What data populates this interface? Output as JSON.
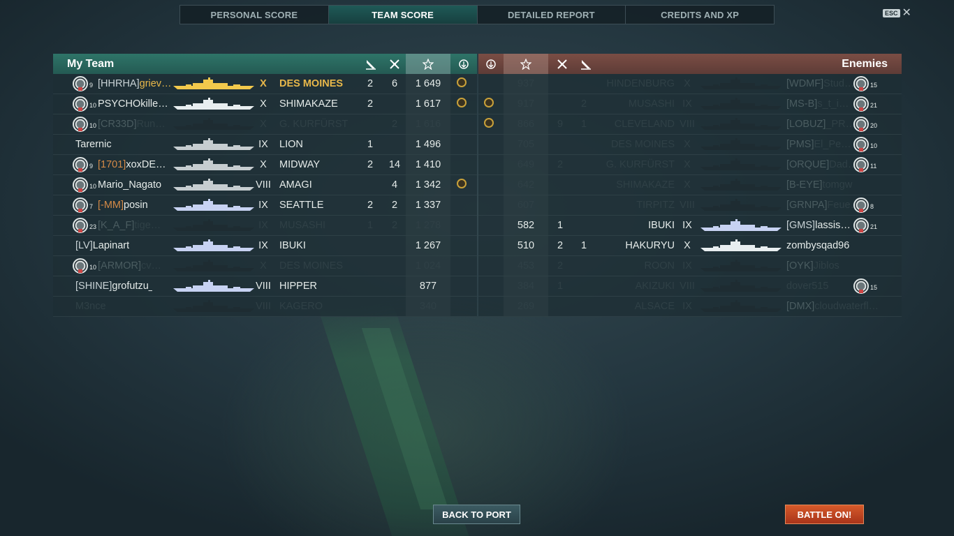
{
  "tabs": [
    "PERSONAL SCORE",
    "TEAM SCORE",
    "DETAILED REPORT",
    "CREDITS AND XP"
  ],
  "active_tab": 1,
  "close": {
    "key": "ESC",
    "glyph": "✕"
  },
  "left_header": {
    "title": "My Team"
  },
  "right_header": {
    "title": "Enemies"
  },
  "buttons": {
    "back": "BACK TO PORT",
    "battle": "BATTLE ON!"
  },
  "colors": {
    "my_team": "#2e7468",
    "enemies": "#7a4d44",
    "highlight": "#e8b84a",
    "clan_orange": "#d48a47"
  },
  "my_team": [
    {
      "rank": "9",
      "clan": "[HHRHA]",
      "clan_color": "white",
      "name": "griev…",
      "tier": "X",
      "ship": "DES MOINES",
      "k1": "2",
      "k2": "6",
      "score": "1 649",
      "medal": true,
      "self": true,
      "dead": false,
      "ship_color": "gold"
    },
    {
      "rank": "10",
      "clan": "",
      "name": "PSYCHOkille…",
      "tier": "X",
      "ship": "SHIMAKAZE",
      "k1": "2",
      "k2": "",
      "score": "1 617",
      "medal": true,
      "dead": false,
      "ship_color": "white"
    },
    {
      "rank": "10",
      "clan": "[CR33D]",
      "clan_color": "white",
      "name": "Run…",
      "tier": "X",
      "ship": "G. KURFÜRST",
      "k1": "",
      "k2": "2",
      "score": "1 616",
      "medal": false,
      "dead": true,
      "ship_color": "dark"
    },
    {
      "rank": "",
      "clan": "",
      "name": "Tarernic",
      "tier": "IX",
      "ship": "LION",
      "k1": "1",
      "k2": "",
      "score": "1 496",
      "medal": false,
      "dead": false,
      "ship_color": "grey"
    },
    {
      "rank": "9",
      "clan": "[1701]",
      "clan_color": "orange",
      "name": "xoxDE…",
      "tier": "X",
      "ship": "MIDWAY",
      "k1": "2",
      "k2": "14",
      "score": "1 410",
      "medal": false,
      "dead": false,
      "ship_color": "grey"
    },
    {
      "rank": "10",
      "clan": "",
      "name": "Mario_Nagato",
      "tier": "VIII",
      "ship": "AMAGI",
      "k1": "",
      "k2": "4",
      "score": "1 342",
      "medal": true,
      "dead": false,
      "ship_color": "grey"
    },
    {
      "rank": "7",
      "clan": "[-MM]",
      "clan_color": "orange",
      "name": "posin",
      "tier": "IX",
      "ship": "SEATTLE",
      "k1": "2",
      "k2": "2",
      "score": "1 337",
      "medal": false,
      "dead": false,
      "ship_color": "blue"
    },
    {
      "rank": "23",
      "clan": "[K_A_F]",
      "clan_color": "white",
      "name": "tige…",
      "tier": "IX",
      "ship": "MUSASHI",
      "k1": "1",
      "k2": "2",
      "score": "1 278",
      "medal": false,
      "dead": true,
      "ship_color": "dark"
    },
    {
      "rank": "",
      "clan": "[LV]",
      "clan_color": "white",
      "name": "Lapinart",
      "tier": "IX",
      "ship": "IBUKI",
      "k1": "",
      "k2": "",
      "score": "1 267",
      "medal": false,
      "dead": false,
      "ship_color": "blue"
    },
    {
      "rank": "10",
      "clan": "[ARMOR]",
      "clan_color": "orange",
      "name": "cv…",
      "tier": "X",
      "ship": "DES MOINES",
      "k1": "",
      "k2": "",
      "score": "1 024",
      "medal": false,
      "dead": true,
      "ship_color": "dark"
    },
    {
      "rank": "",
      "clan": "[SHINE]",
      "clan_color": "white",
      "name": "grofutzu_1",
      "tier": "VIII",
      "ship": "HIPPER",
      "k1": "",
      "k2": "",
      "score": "877",
      "medal": false,
      "dead": false,
      "ship_color": "blue"
    },
    {
      "rank": "",
      "clan": "",
      "name": "M3nce",
      "tier": "VIII",
      "ship": "KAGERO",
      "k1": "",
      "k2": "",
      "score": "340",
      "medal": false,
      "dead": true,
      "ship_color": "dark"
    }
  ],
  "enemies": [
    {
      "score": "937",
      "k2": "",
      "k1": "",
      "medal": false,
      "ship": "HINDENBURG",
      "tier": "X",
      "clan": "[WDMF]",
      "clan_color": "orange",
      "name": "Stud…",
      "rank": "15",
      "dead": true
    },
    {
      "score": "917",
      "k2": "",
      "k1": "2",
      "medal": true,
      "ship": "MUSASHI",
      "tier": "IX",
      "clan": "[MS-B]",
      "clan_color": "orange",
      "name": "s_t_i…",
      "rank": "21",
      "dead": true
    },
    {
      "score": "866",
      "k2": "9",
      "k1": "1",
      "medal": true,
      "ship": "CLEVELAND",
      "tier": "VIII",
      "clan": "[LOBUZ]",
      "clan_color": "orange",
      "name": "_PR…",
      "rank": "20",
      "dead": true
    },
    {
      "score": "705",
      "k2": "",
      "k1": "",
      "medal": false,
      "ship": "DES MOINES",
      "tier": "X",
      "clan": "[PMS]",
      "clan_color": "orange",
      "name": "El_Pe…",
      "rank": "10",
      "dead": true
    },
    {
      "score": "649",
      "k2": "2",
      "k1": "",
      "medal": false,
      "ship": "G. KURFÜRST",
      "tier": "X",
      "clan": "[ORQUE]",
      "clan_color": "orange",
      "name": "Dad…",
      "rank": "11",
      "dead": true
    },
    {
      "score": "642",
      "k2": "",
      "k1": "",
      "medal": false,
      "ship": "SHIMAKAZE",
      "tier": "X",
      "clan": "[B-EYE]",
      "clan_color": "white",
      "name": "tomgw",
      "rank": "",
      "dead": true
    },
    {
      "score": "607",
      "k2": "",
      "k1": "",
      "medal": false,
      "ship": "TIRPITZ",
      "tier": "VIII",
      "clan": "[GRNPA]",
      "clan_color": "orange",
      "name": "Feue…",
      "rank": "8",
      "dead": true
    },
    {
      "score": "582",
      "k2": "1",
      "k1": "",
      "medal": false,
      "ship": "IBUKI",
      "tier": "IX",
      "clan": "[GMS]",
      "clan_color": "white",
      "name": "lassis…",
      "rank": "21",
      "dead": false
    },
    {
      "score": "510",
      "k2": "2",
      "k1": "1",
      "medal": false,
      "ship": "HAKURYU",
      "tier": "X",
      "clan": "",
      "clan_color": "white",
      "name": "zombysqad96",
      "rank": "",
      "dead": false
    },
    {
      "score": "453",
      "k2": "2",
      "k1": "",
      "medal": false,
      "ship": "ROON",
      "tier": "IX",
      "clan": "[OYK]",
      "clan_color": "white",
      "name": "Jiblos",
      "rank": "",
      "dead": true
    },
    {
      "score": "384",
      "k2": "1",
      "k1": "",
      "medal": false,
      "ship": "AKIZUKI",
      "tier": "VIII",
      "clan": "",
      "clan_color": "white",
      "name": "dover515",
      "rank": "15",
      "dead": true
    },
    {
      "score": "269",
      "k2": "",
      "k1": "",
      "medal": false,
      "ship": "ALSACE",
      "tier": "IX",
      "clan": "[DMX]",
      "clan_color": "orange",
      "name": "cloudwaterfl…",
      "rank": "",
      "dead": true
    }
  ]
}
